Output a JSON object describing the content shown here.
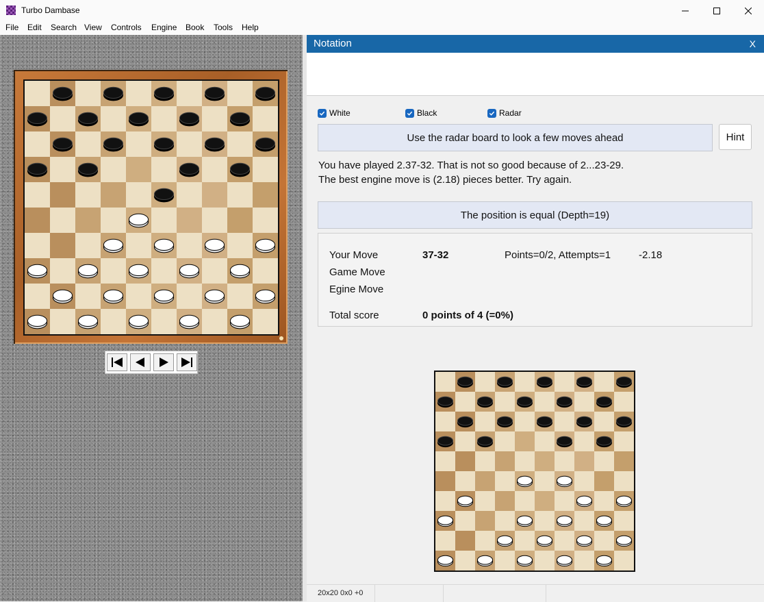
{
  "window": {
    "title": "Turbo Dambase"
  },
  "menu": {
    "items": [
      "File",
      "Edit",
      "Search",
      "View",
      "Controls",
      "Engine",
      "Book",
      "Tools",
      "Help"
    ]
  },
  "notation": {
    "title": "Notation",
    "close_label": "X"
  },
  "options": {
    "white_label": "White",
    "black_label": "Black",
    "radar_label": "Radar"
  },
  "radar_button_label": "Use the radar board to look a few moves ahead",
  "hint_button_label": "Hint",
  "message": {
    "line1": "You have played 2.37-32. That is not so good because of 2...23-29.",
    "line2": "The best engine move is (2.18) pieces better. Try again."
  },
  "evaluation": "The position is equal (Depth=19)",
  "score": {
    "your_move_label": "Your Move",
    "your_move_value": "37-32",
    "points_text": "Points=0/2, Attempts=1",
    "delta": "-2.18",
    "game_move_label": "Game Move",
    "engine_move_label": "Egine Move",
    "total_label": "Total score",
    "total_value": "0 points of 4 (=0%)"
  },
  "status": {
    "text": "20x20 0x0 +0"
  },
  "colors": {
    "header_blue": "#1867a7",
    "light_square": "#ede0c4",
    "dark_square": "#c9a677",
    "black_piece": "#111111",
    "white_piece": "#ffffff"
  },
  "main_board": {
    "size": 10,
    "black_squares": [
      1,
      2,
      3,
      4,
      5,
      6,
      7,
      8,
      9,
      10,
      11,
      12,
      13,
      14,
      15,
      16,
      17,
      19,
      20,
      23
    ],
    "white_squares": [
      28,
      32,
      33,
      34,
      35,
      36,
      37,
      38,
      39,
      40,
      41,
      42,
      43,
      44,
      45,
      46,
      47,
      48,
      49,
      50
    ]
  },
  "radar_board": {
    "size": 10,
    "black_squares": [
      1,
      2,
      3,
      4,
      5,
      6,
      7,
      8,
      9,
      10,
      11,
      12,
      13,
      14,
      15,
      16,
      17,
      19,
      20
    ],
    "white_squares": [
      28,
      29,
      31,
      34,
      35,
      36,
      38,
      39,
      40,
      42,
      43,
      44,
      45,
      46,
      47,
      48,
      49,
      50
    ]
  },
  "icons": {
    "nav": [
      "first-move-icon",
      "prev-move-icon",
      "next-move-icon",
      "last-move-icon"
    ]
  }
}
